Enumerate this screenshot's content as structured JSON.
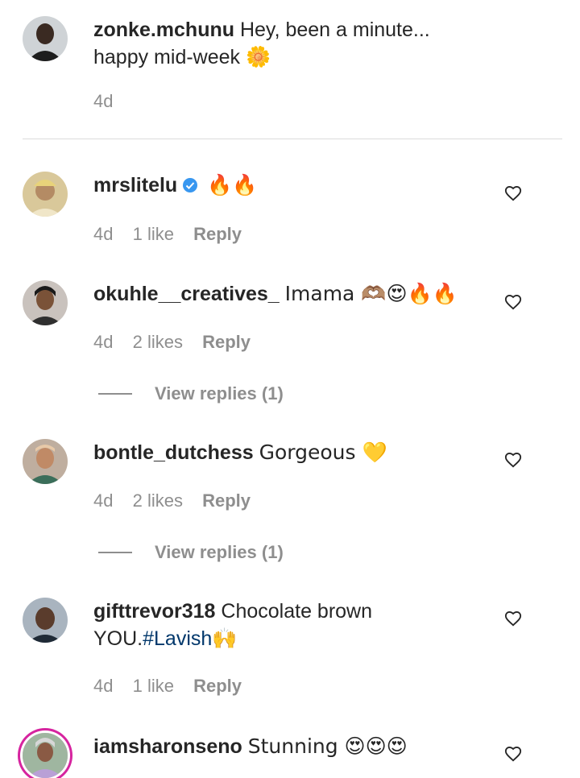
{
  "comments": [
    {
      "username": "zonke.mchunu",
      "text": "Hey, been a minute... happy mid-week 🌼",
      "time": "4d",
      "likes": "",
      "reply": "",
      "verified": false
    },
    {
      "username": "mrslitelu",
      "text": "🔥🔥",
      "time": "4d",
      "likes": "1 like",
      "reply": "Reply",
      "verified": true
    },
    {
      "username": "okuhle__creatives_",
      "text": "Imama 🫶🏽😍🔥🔥",
      "time": "4d",
      "likes": "2 likes",
      "reply": "Reply",
      "view_replies": "View replies (1)"
    },
    {
      "username": "bontle_dutchess",
      "text": "Gorgeous 💛",
      "time": "4d",
      "likes": "2 likes",
      "reply": "Reply",
      "view_replies": "View replies (1)"
    },
    {
      "username": "gifttrevor318",
      "text_before": "Chocolate brown YOU.",
      "hashtag": "#Lavish",
      "text_after": "🙌",
      "time": "4d",
      "likes": "1 like",
      "reply": "Reply"
    },
    {
      "username": "iamsharonseno",
      "text": "Stunning 😍😍😍"
    }
  ],
  "icons": {
    "like": "heart-outline-icon",
    "verified": "verified-badge-icon"
  },
  "colors": {
    "verified": "#3897f0",
    "hashtag": "#00376b",
    "meta": "#8e8e8e",
    "story_ring": "#d6249f"
  }
}
